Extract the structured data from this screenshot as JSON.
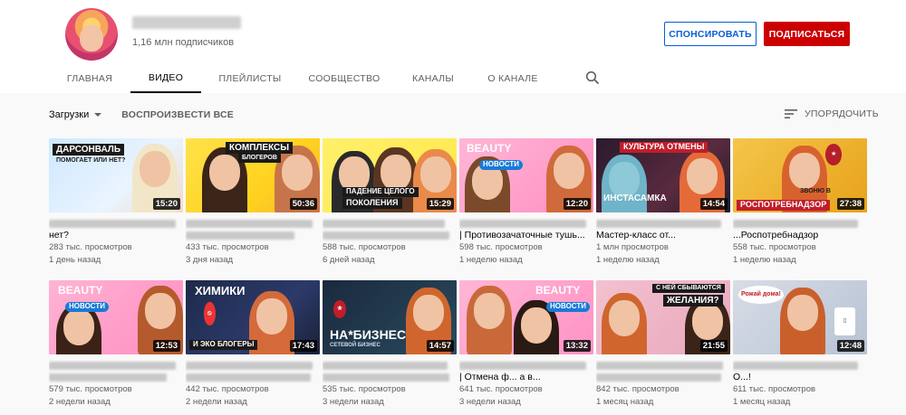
{
  "channel": {
    "subscribers": "1,16 млн подписчиков",
    "sponsor_label": "СПОНСИРОВАТЬ",
    "subscribe_label": "ПОДПИСАТЬСЯ"
  },
  "tabs": [
    {
      "label": "ГЛАВНАЯ"
    },
    {
      "label": "ВИДЕО"
    },
    {
      "label": "ПЛЕЙЛИСТЫ"
    },
    {
      "label": "СООБЩЕСТВО"
    },
    {
      "label": "КАНАЛЫ"
    },
    {
      "label": "О КАНАЛЕ"
    }
  ],
  "toolbar": {
    "filter_label": "Загрузки",
    "play_all_label": "ВОСПРОИЗВЕСТИ ВСЕ",
    "sort_label": "УПОРЯДОЧИТЬ"
  },
  "videos": [
    {
      "overlay": "ДАРСОНВАЛЬ",
      "overlay2": "ПОМОГАЕТ ИЛИ НЕТ?",
      "duration": "15:20",
      "title_visible": "нет?",
      "views": "283 тыс. просмотров",
      "age": "1 день назад"
    },
    {
      "overlay": "КОМПЛЕКСЫ",
      "overlay2": "БЛОГЕРОВ",
      "duration": "50:36",
      "title_visible": "",
      "views": "433 тыс. просмотров",
      "age": "3 дня назад"
    },
    {
      "overlay": "ПАДЕНИЕ ЦЕЛОГО",
      "overlay2": "ПОКОЛЕНИЯ",
      "duration": "15:29",
      "title_visible": "",
      "views": "588 тыс. просмотров",
      "age": "6 дней назад"
    },
    {
      "overlay": "BEAUTY",
      "overlay2": "НОВОСТИ",
      "duration": "12:20",
      "title_visible": "| Противозачаточные тушь...",
      "views": "598 тыс. просмотров",
      "age": "1 неделю назад"
    },
    {
      "overlay": "КУЛЬТУРА ОТМЕНЫ",
      "overlay2": "ИНСТАСАМКА",
      "duration": "14:54",
      "title_visible": "Мастер-класс от...",
      "views": "1 млн просмотров",
      "age": "1 неделю назад"
    },
    {
      "overlay": "ЗВОНЮ В",
      "overlay2": "РОСПОТРЕБНАДЗОР",
      "duration": "27:38",
      "title_visible": "...Роспотребнадзор",
      "views": "558 тыс. просмотров",
      "age": "1 неделю назад"
    },
    {
      "overlay": "BEAUTY",
      "overlay2": "НОВОСТИ",
      "duration": "12:53",
      "title_visible": "",
      "views": "579 тыс. просмотров",
      "age": "2 недели назад"
    },
    {
      "overlay": "ХИМИКИ",
      "overlay2": "И ЭКО БЛОГЕРЫ",
      "duration": "17:43",
      "title_visible": "",
      "views": "442 тыс. просмотров",
      "age": "2 недели назад"
    },
    {
      "overlay": "НА*БИЗНЕС",
      "overlay2": "СЕТЕВОЙ БИЗНЕС",
      "duration": "14:57",
      "title_visible": "",
      "views": "535 тыс. просмотров",
      "age": "3 недели назад"
    },
    {
      "overlay": "BEAUTY",
      "overlay2": "НОВОСТИ",
      "duration": "13:32",
      "title_visible": "| Отмена ф... а в...",
      "views": "641 тыс. просмотров",
      "age": "3 недели назад"
    },
    {
      "overlay": "С НЕЙ СБЫВАЮТСЯ",
      "overlay2": "ЖЕЛАНИЯ?",
      "duration": "21:55",
      "title_visible": "",
      "views": "842 тыс. просмотров",
      "age": "1 месяц назад"
    },
    {
      "overlay": "Рожай дома!",
      "overlay2": "",
      "duration": "12:48",
      "title_visible": "О...!",
      "views": "611 тыс. просмотров",
      "age": "1 месяц назад"
    }
  ],
  "colors": {
    "subscribe": "#cc0000",
    "sponsor": "#065fd4"
  }
}
